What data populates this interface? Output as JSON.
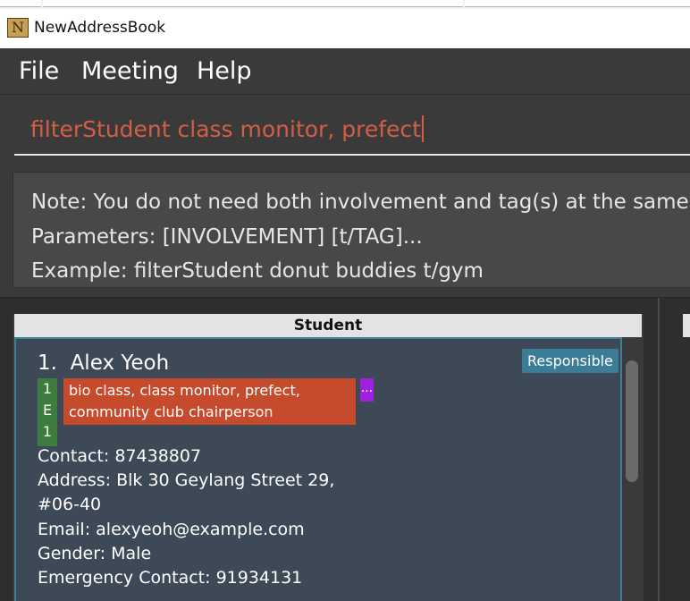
{
  "window": {
    "title": "NewAddressBook",
    "icon": "N",
    "icon_name": "app-logo-icon"
  },
  "menu": {
    "items": [
      "File",
      "Meeting",
      "Help"
    ]
  },
  "command_box": {
    "value": "filterStudent class monitor, prefect"
  },
  "result_display": {
    "lines": [
      "Note: You do not need both involvement and tag(s) at the same",
      "Parameters: [INVOLVEMENT] [t/TAG]...",
      "Example: filterStudent donut buddies t/gym"
    ]
  },
  "student_panel": {
    "header": "Student",
    "cards": [
      {
        "index": "1.",
        "name": "Alex Yeoh",
        "badge": "Responsible",
        "class_tag": [
          "1",
          "E",
          "1"
        ],
        "involvement": [
          "bio class, class monitor, prefect,",
          "community club chairperson"
        ],
        "more_tag": "...",
        "contact": "Contact: 87438807",
        "address_line1": "Address: Blk 30 Geylang Street 29,",
        "address_line2": "#06-40",
        "email": "Email: alexyeoh@example.com",
        "gender": "Gender: Male",
        "emergency_contact": "Emergency Contact: 91934131"
      }
    ]
  },
  "colors": {
    "dark_bg": "#3a3a3a",
    "card_bg": "#3d4957",
    "card_border": "#3f7f97",
    "command_text": "#d35e46",
    "class_tag": "#3e7b3e",
    "involvement_tag": "#c54b2c",
    "more_tag": "#a020e0",
    "badge": "#3b7d96"
  }
}
